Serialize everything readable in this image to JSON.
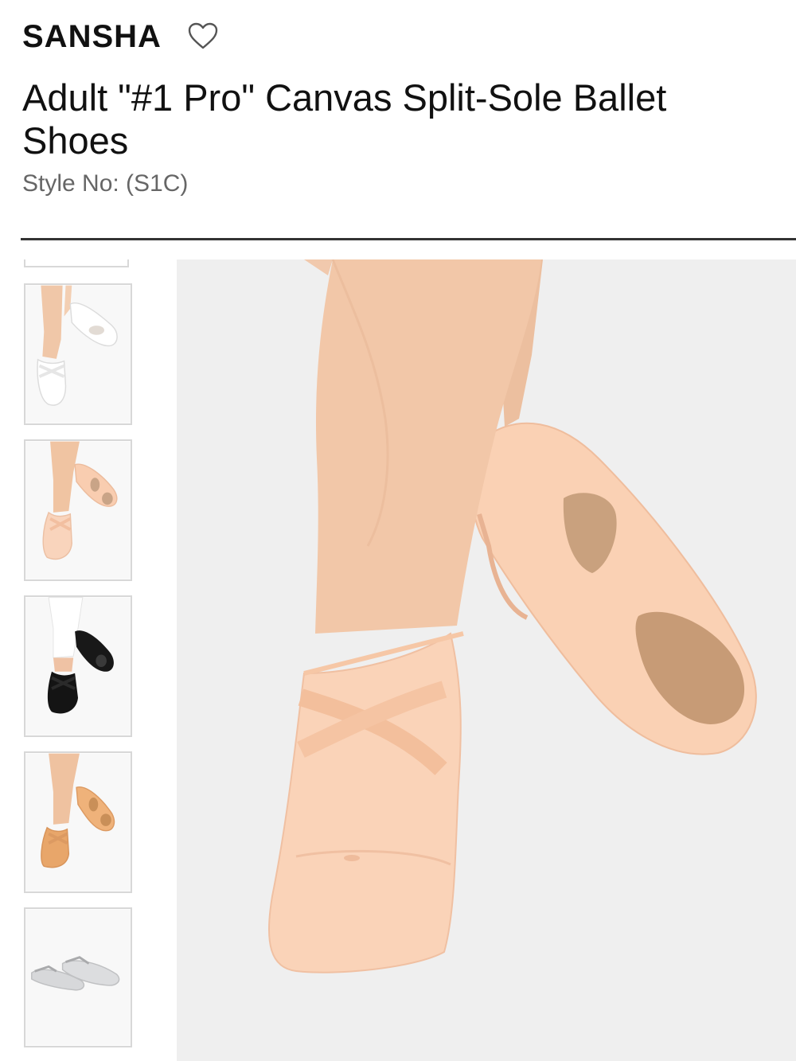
{
  "product": {
    "brand": "SANSHA",
    "title": "Adult \"#1 Pro\" Canvas Split-Sole Ballet Shoes",
    "style_no": "Style No: (S1C)"
  },
  "icons": {
    "favorite": "heart-outline-icon"
  },
  "colors": {
    "divider": "#333333",
    "thumb_border": "#d8d8d8",
    "image_bg": "#efefef"
  },
  "gallery": {
    "thumbnails": [
      {
        "variant": "white"
      },
      {
        "variant": "pink"
      },
      {
        "variant": "black"
      },
      {
        "variant": "tan"
      },
      {
        "variant": "grey"
      }
    ]
  }
}
